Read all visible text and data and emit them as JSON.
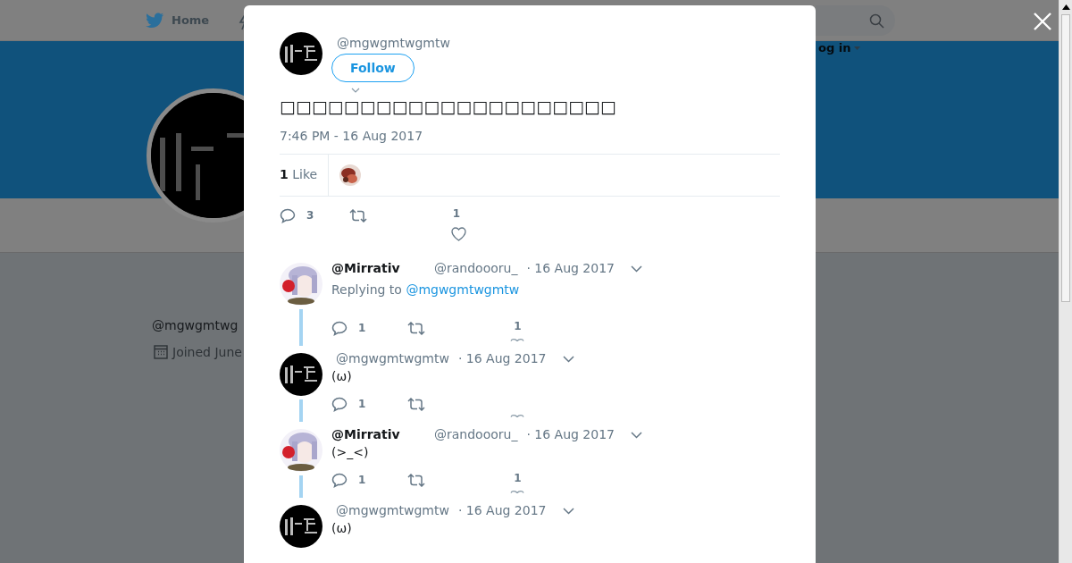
{
  "nav": {
    "home": "Home",
    "login": "og in"
  },
  "profile": {
    "handle": "@mgwgmtwg",
    "joined": "Joined June"
  },
  "tweet": {
    "handle": "@mgwgmtwgmtw",
    "follow": "Follow",
    "text": "□□□□□□□□□□□□□□□□□□□□□",
    "time": "7:46 PM - 16 Aug 2017",
    "like_count": "1",
    "like_label": "Like",
    "replies": "3",
    "likes": "1"
  },
  "replies": [
    {
      "kind": "light",
      "name": "@Mirrativ",
      "handle": "@randoooru_",
      "date": "· 16 Aug 2017",
      "replying_label": "Replying to",
      "replying_to": "@mgwgmtwgmtw",
      "replies": "1",
      "likes": "1"
    },
    {
      "kind": "dark",
      "handle": "@mgwgmtwgmtw",
      "date": "· 16 Aug 2017",
      "text": "(ω)",
      "replies": "1"
    },
    {
      "kind": "light",
      "name": "@Mirrativ",
      "handle": "@randoooru_",
      "date": "· 16 Aug 2017",
      "text": "(>_<)",
      "replies": "1",
      "likes": "1"
    },
    {
      "kind": "dark",
      "handle": "@mgwgmtwgmtw",
      "date": "· 16 Aug 2017",
      "text": "(ω)"
    }
  ]
}
